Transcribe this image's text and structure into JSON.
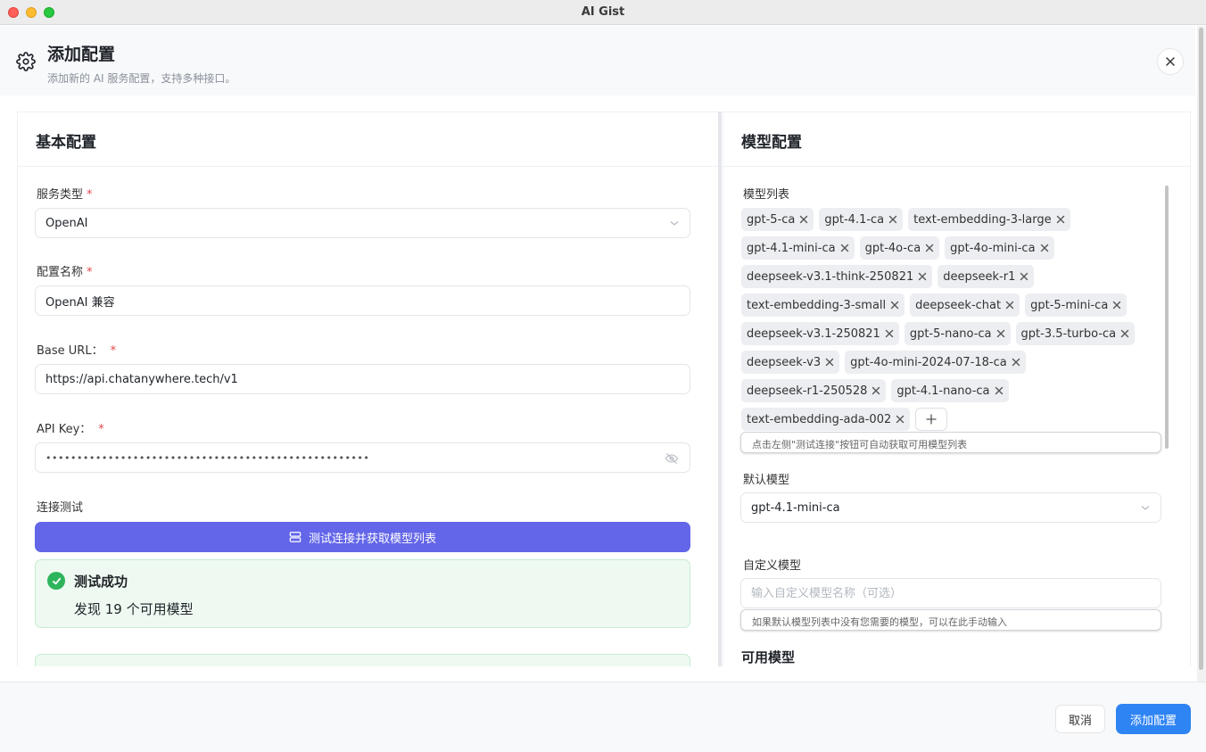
{
  "window": {
    "title": "AI Gist"
  },
  "header": {
    "title": "添加配置",
    "subtitle": "添加新的 AI 服务配置，支持多种接口。"
  },
  "left": {
    "heading": "基本配置",
    "service_type": {
      "label": "服务类型",
      "value": "OpenAI"
    },
    "config_name": {
      "label": "配置名称",
      "value": "OpenAI 兼容"
    },
    "base_url": {
      "label": "Base URL：",
      "value": "https://api.chatanywhere.tech/v1"
    },
    "api_key": {
      "label": "API Key：",
      "masked": "••••••••••••••••••••••••••••••••••••••••••••••••••••"
    },
    "test": {
      "label": "连接测试",
      "button": "测试连接并获取模型列表",
      "success_title": "测试成功",
      "success_desc": "发现 19 个可用模型"
    }
  },
  "right": {
    "heading": "模型配置",
    "models_label": "模型列表",
    "models": [
      "gpt-5-ca",
      "gpt-4.1-ca",
      "text-embedding-3-large",
      "gpt-4.1-mini-ca",
      "gpt-4o-ca",
      "gpt-4o-mini-ca",
      "deepseek-v3.1-think-250821",
      "deepseek-r1",
      "text-embedding-3-small",
      "deepseek-chat",
      "gpt-5-mini-ca",
      "deepseek-v3.1-250821",
      "gpt-5-nano-ca",
      "gpt-3.5-turbo-ca",
      "deepseek-v3",
      "gpt-4o-mini-2024-07-18-ca",
      "deepseek-r1-250528",
      "gpt-4.1-nano-ca",
      "text-embedding-ada-002"
    ],
    "models_hint": "点击左侧\"测试连接\"按钮可自动获取可用模型列表",
    "default_model": {
      "label": "默认模型",
      "value": "gpt-4.1-mini-ca"
    },
    "custom_model": {
      "label": "自定义模型",
      "placeholder": "输入自定义模型名称（可选）",
      "hint": "如果默认模型列表中没有您需要的模型，可以在此手动输入"
    },
    "available_title": "可用模型"
  },
  "footer": {
    "cancel": "取消",
    "submit": "添加配置"
  },
  "colors": {
    "primary_button": "#6366e8",
    "submit_button": "#2f84f3",
    "success": "#2eb55c",
    "required": "#e5484d"
  }
}
